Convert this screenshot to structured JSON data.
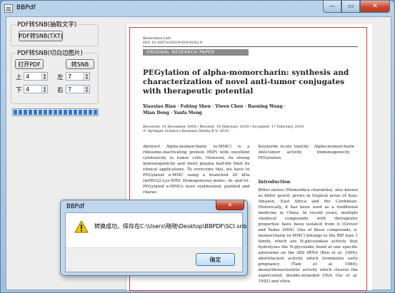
{
  "window": {
    "title": "BBPdf",
    "minimize": "—",
    "maximize": "▭",
    "close": "✕"
  },
  "group_text": {
    "title": "PDF转SNB(抽取文字)",
    "button": "PDF转SNB(TXT)"
  },
  "group_image": {
    "title": "PDF转SNB(切白边图片)",
    "open_button": "打开PDF",
    "convert_button": "转SNB",
    "fields": [
      {
        "label": "上",
        "value": "4"
      },
      {
        "label": "左",
        "value": "7"
      },
      {
        "label": "下",
        "value": "4"
      },
      {
        "label": "右",
        "value": "7"
      }
    ]
  },
  "progress": {
    "percent": 100
  },
  "document": {
    "journal": "Biotechnol Lett",
    "doi": "DOI 10.1007/s10529-010-0242-8",
    "type": "ORIGINAL RESEARCH PAPER",
    "title": "PEGylation of alpha-momorcharin: synthesis and characterization of novel anti-tumor conjugates with therapeutic potential",
    "authors": "Xiaoxiao Bian · Fubing Shen · Yiwen Chen · Baoning Wang · Mian Deng · Yanfa Meng",
    "dates": "Received: 14 December 2009 / Revised: 16 February 2010 / Accepted: 17 February 2010",
    "copyright": "© Springer Science+Business Media B.V. 2010",
    "abstract": "Abstract  Alpha-momorcharin (α-MMC) is a ribosome-inactivating protein (RIP) with excellent cytotoxicity to tumor cells. However, its strong immunogenicity and short plasma half-life limit its clinical applications. To overcome this, we have to PEGylated α-MMC using a branched 20 kDa (mPEG)2-Lys-NHS. Homogeneous mono-, di- and tri-PEGylated α-MMCs were synthesized, purified and charac-",
    "keywords": "Keywords  Acute toxicity · Alpha-momorcharin · Anti-tumor activity · Immunogenicity · PEGylation",
    "intro_heading": "Introduction",
    "intro": "Bitter melon (Momordica charantia), also known as bitter gourd, grows in tropical areas of Asia, Amazon, East Africa and the Caribbean. Historically, it has been used as a traditional medicine in China. In recent years, multiple chemical compounds with therapeutic properties have been isolated from it (Grover and Yadav 2004). One of these compounds, α-momorcharin (α-MMC) belongs to the RIP type 1 family, which are N-glycosidase activity that hydrolyzes the N-glycosidic bond at one specific adenosine on the 28S rRNA (Ren et al. 1994); abortifacient activity which terminates early pregnancy (Tam et al. 1984); deoxyribonucleolytic activity which cleaves the supercoiled, double-stranded DNA (Go et al. 1992) and ultra-"
  },
  "dialog": {
    "title": "BBPdf",
    "close": "✕",
    "message": "转换成功，保存在C:\\Users\\晓晓\\Desktop\\BBPDF\\SCI.snb",
    "ok": "确定"
  }
}
